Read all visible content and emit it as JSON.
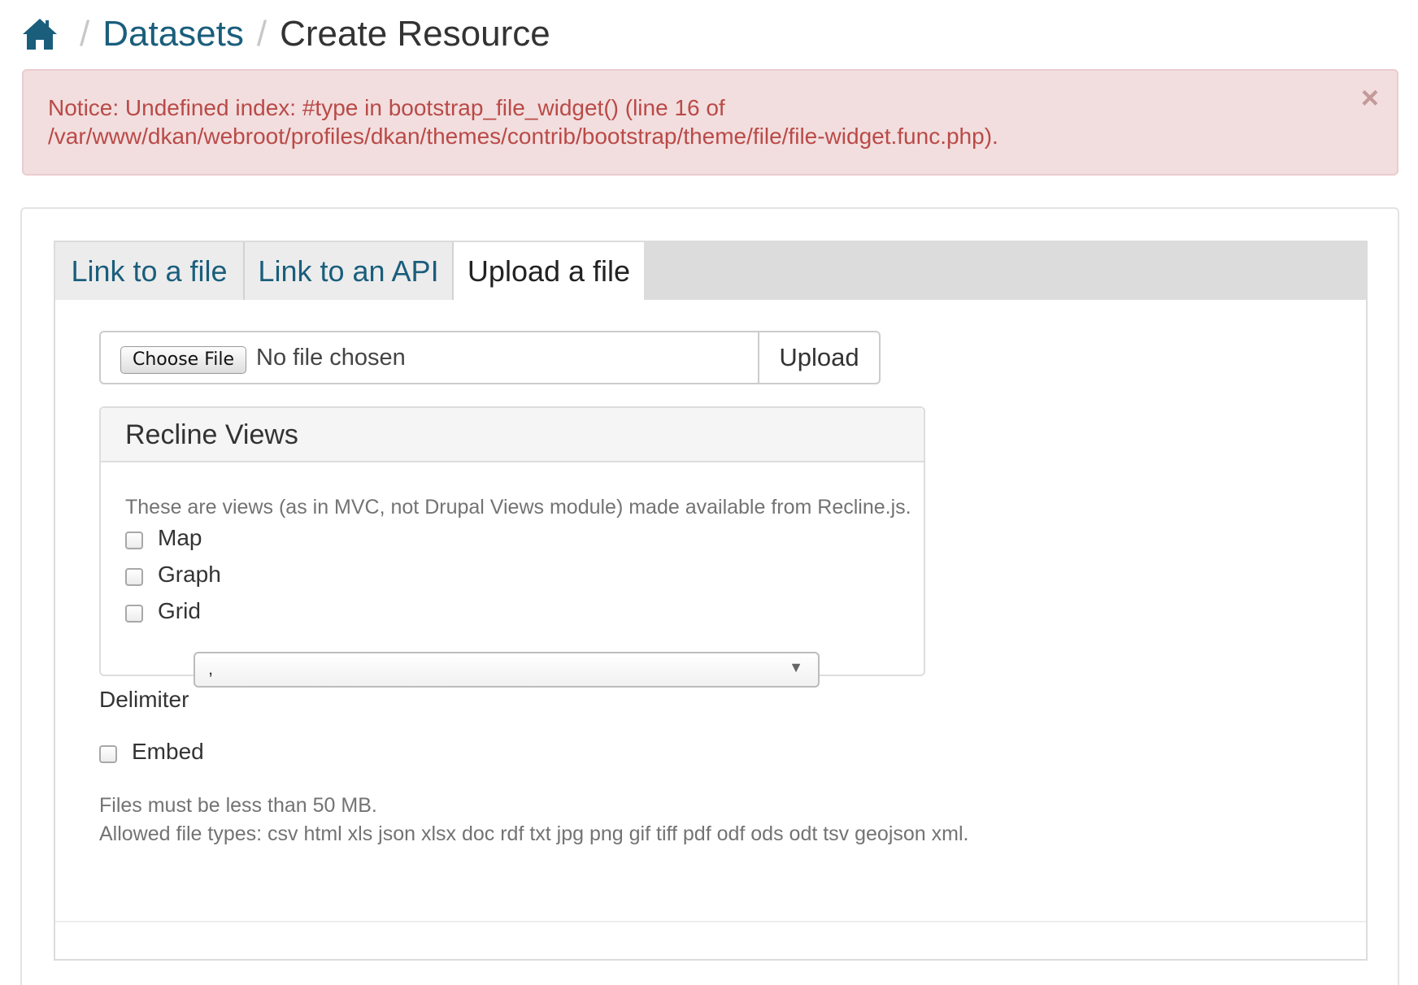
{
  "breadcrumb": {
    "home_icon": "home-icon",
    "separator": "/",
    "datasets": "Datasets",
    "current": "Create Resource"
  },
  "alert": {
    "line1": "Notice: Undefined index: #type in bootstrap_file_widget() (line 16 of",
    "line2": "/var/www/dkan/webroot/profiles/dkan/themes/contrib/bootstrap/theme/file/file-widget.func.php).",
    "close": "×"
  },
  "tabs": {
    "link_file": "Link to a file",
    "link_api": "Link to an API",
    "upload_file": "Upload a file"
  },
  "file_input": {
    "choose_label": "Choose File",
    "status": "No file chosen",
    "upload_label": "Upload"
  },
  "recline": {
    "title": "Recline Views",
    "description": "These are views (as in MVC, not Drupal Views module) made available from Recline.js.",
    "options": [
      "Map",
      "Graph",
      "Grid"
    ]
  },
  "delimiter": {
    "label": "Delimiter",
    "value": ","
  },
  "embed": {
    "label": "Embed"
  },
  "help": {
    "size": "Files must be less than 50 MB.",
    "types": "Allowed file types: csv html xls json xlsx doc rdf txt jpg png gif tiff pdf odf ods odt tsv geojson xml."
  },
  "colors": {
    "link": "#1a5e7c",
    "alert_bg": "#f2dede",
    "alert_text": "#b94a48"
  }
}
